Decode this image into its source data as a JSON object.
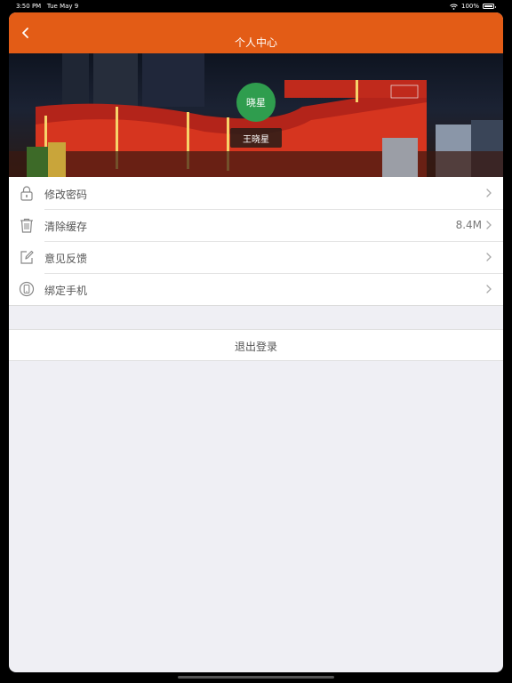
{
  "status_bar": {
    "time": "3:50 PM",
    "date": "Tue May 9",
    "battery_percent": "100%",
    "icons": [
      "wifi-icon",
      "battery-icon"
    ]
  },
  "navbar": {
    "title": "个人中心",
    "back_icon": "chevron-left-icon",
    "background_color": "#e35c16"
  },
  "profile": {
    "avatar_text": "晓星",
    "avatar_color": "#2f9d4e",
    "user_name": "王晓星"
  },
  "menu": {
    "items": [
      {
        "label": "修改密码",
        "value": "",
        "icon": "lock-icon"
      },
      {
        "label": "清除缓存",
        "value": "8.4M",
        "icon": "trash-icon"
      },
      {
        "label": "意见反馈",
        "value": "",
        "icon": "edit-icon"
      },
      {
        "label": "绑定手机",
        "value": "",
        "icon": "phone-icon"
      }
    ]
  },
  "logout": {
    "label": "退出登录"
  }
}
